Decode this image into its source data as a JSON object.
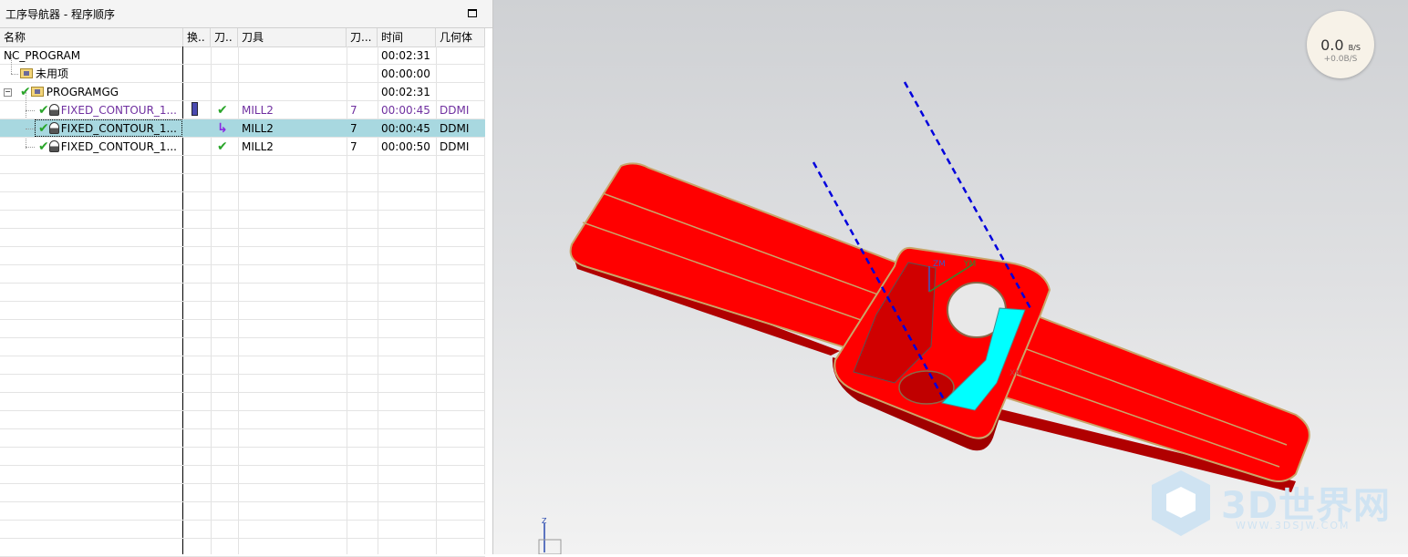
{
  "navigator": {
    "title": "工序导航器 - 程序顺序",
    "columns": {
      "name": "名称",
      "swap": "换..",
      "path": "刀..",
      "tool": "刀具",
      "toolnum": "刀...",
      "time": "时间",
      "geometry": "几何体"
    },
    "rows": [
      {
        "name": "NC_PROGRAM",
        "tool": "",
        "toolnum": "",
        "time": "00:02:31",
        "geometry": ""
      },
      {
        "name": "未用项",
        "tool": "",
        "toolnum": "",
        "time": "00:00:00",
        "geometry": ""
      },
      {
        "name": "PROGRAMGG",
        "tool": "",
        "toolnum": "",
        "time": "00:02:31",
        "geometry": ""
      },
      {
        "name": "FIXED_CONTOUR_1...",
        "tool": "MILL2",
        "toolnum": "7",
        "time": "00:00:45",
        "geometry": "DDMI"
      },
      {
        "name": "FIXED_CONTOUR_1...",
        "tool": "MILL2",
        "toolnum": "7",
        "time": "00:00:45",
        "geometry": "DDMI"
      },
      {
        "name": "FIXED_CONTOUR_1...",
        "tool": "MILL2",
        "toolnum": "7",
        "time": "00:00:50",
        "geometry": "DDMI"
      }
    ],
    "selected_row": 4,
    "icons": {
      "check": "check-icon",
      "folder": "folder-icon",
      "operation": "operation-icon",
      "regenerate": "regenerate-arrow-icon",
      "tool_change": "tool-change-icon"
    }
  },
  "viewport": {
    "speed_value": "0.0",
    "speed_unit": "B/S",
    "speed_sub": "+0.0B/S",
    "axis_labels": {
      "z": "Z",
      "zm": "ZM",
      "ym": "YM",
      "xm": "XM"
    },
    "watermark": {
      "text": "3D世界网",
      "url": "WWW.3DSJW.COM"
    }
  },
  "colors": {
    "selection": "#a8d8e0",
    "part_red": "#ff0000",
    "edge_tan": "#c9a56a",
    "toolpath_blue": "#0000dd",
    "cut_cyan": "#00ffff",
    "check_green": "#2aa52a",
    "active_purple": "#7030a0"
  }
}
